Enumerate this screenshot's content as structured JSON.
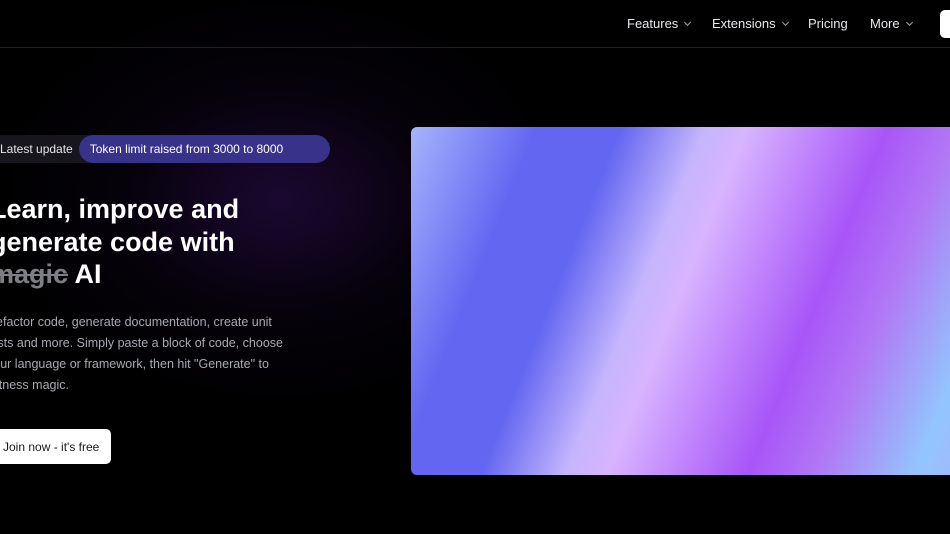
{
  "nav": {
    "items": [
      {
        "label": "Features",
        "has_dropdown": true
      },
      {
        "label": "Extensions",
        "has_dropdown": true
      },
      {
        "label": "Pricing",
        "has_dropdown": false
      },
      {
        "label": "More",
        "has_dropdown": true
      }
    ]
  },
  "badge": {
    "label": "Latest update",
    "message": "Token limit raised from 3000 to 8000"
  },
  "hero": {
    "headline_line1": "Learn, improve and",
    "headline_line2": "generate code with",
    "headline_strike": "magic",
    "headline_end": "AI",
    "description": "Refactor code, generate documentation, create unit tests and more. Simply paste a block of code, choose your language or framework, then hit \"Generate\" to witness magic.",
    "cta_label": "Join now - it's free"
  },
  "colors": {
    "background": "#000000",
    "badge_pill": "#37328a",
    "gradient_indigo": "#6366f1",
    "gradient_violet": "#a855f7",
    "gradient_lavender": "#d8b4fe",
    "gradient_sky": "#93c5fd"
  }
}
